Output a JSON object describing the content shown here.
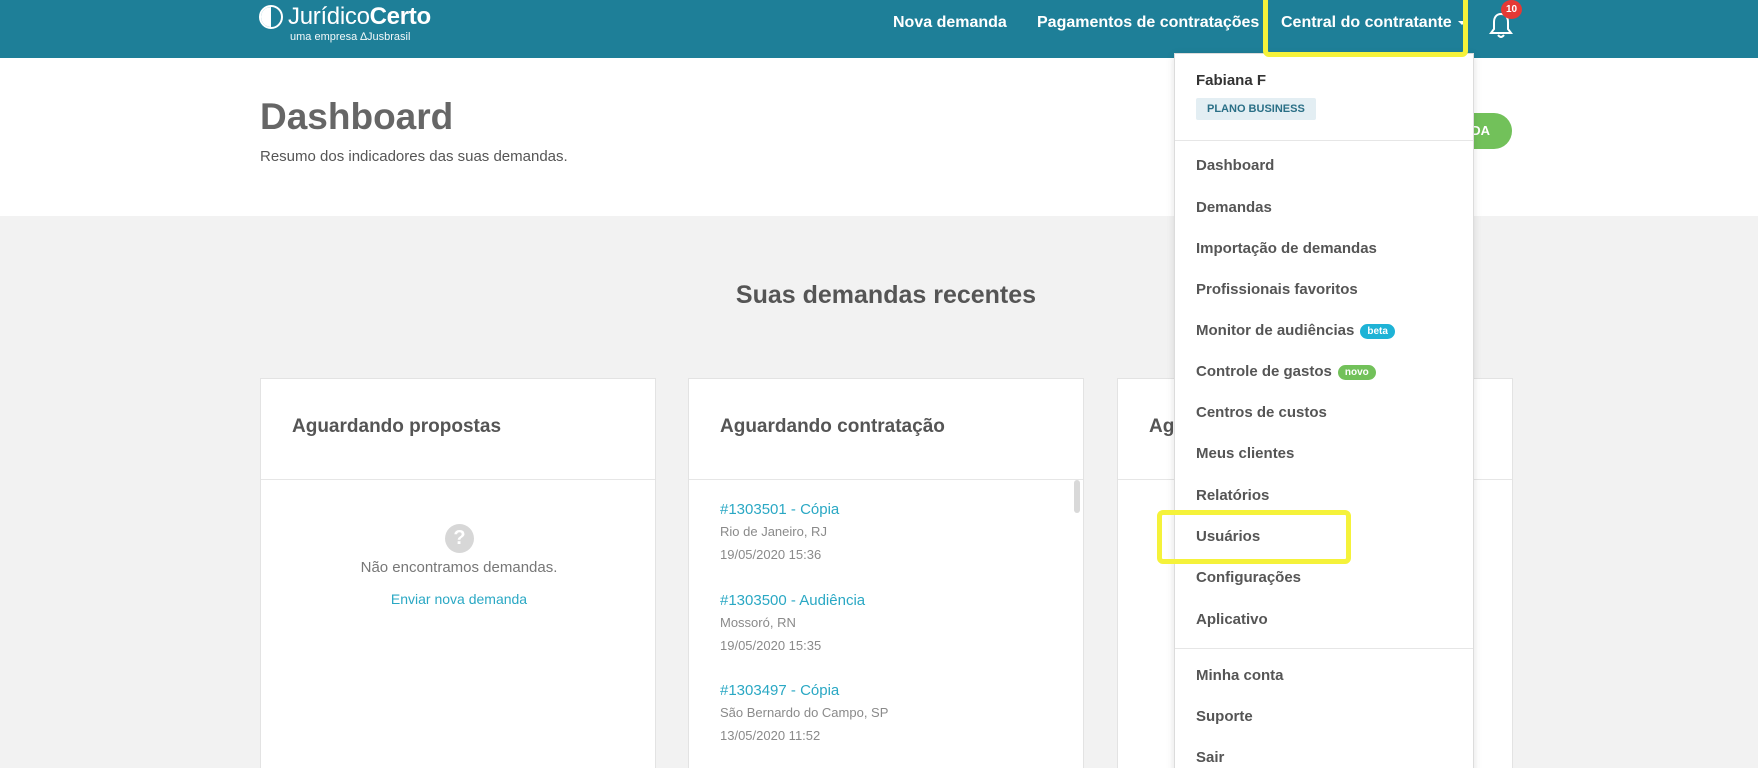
{
  "brand": {
    "name_light": "Jurídico",
    "name_bold": "Certo",
    "subtitle": "uma empresa ∆Jusbrasil"
  },
  "nav": {
    "nova_demanda": "Nova demanda",
    "pagamentos": "Pagamentos de contratações",
    "central": "Central do contratante",
    "notifications_count": "10"
  },
  "header": {
    "title": "Dashboard",
    "subtitle": "Resumo dos indicadores das suas demandas.",
    "button_label": "DA"
  },
  "main": {
    "section_title": "Suas demandas recentes",
    "cards": [
      {
        "title": "Aguardando propostas",
        "empty_text": "Não encontramos demandas.",
        "empty_link": "Enviar nova demanda"
      },
      {
        "title": "Aguardando contratação",
        "demands": [
          {
            "link": "#1303501 - Cópia",
            "location": "Rio de Janeiro, RJ",
            "date": "19/05/2020 15:36"
          },
          {
            "link": "#1303500 - Audiência",
            "location": "Mossoró, RN",
            "date": "19/05/2020 15:35"
          },
          {
            "link": "#1303497 - Cópia",
            "location": "São Bernardo do Campo, SP",
            "date": "13/05/2020 11:52"
          }
        ]
      },
      {
        "title": "Ag"
      }
    ]
  },
  "dropdown": {
    "user_name": "Fabiana F",
    "plan": "PLANO BUSINESS",
    "items": [
      {
        "label": "Dashboard"
      },
      {
        "label": "Demandas"
      },
      {
        "label": "Importação de demandas"
      },
      {
        "label": "Profissionais favoritos"
      },
      {
        "label": "Monitor de audiências",
        "tag": "beta"
      },
      {
        "label": "Controle de gastos",
        "tag": "novo"
      },
      {
        "label": "Centros de custos"
      },
      {
        "label": "Meus clientes"
      },
      {
        "label": "Relatórios"
      },
      {
        "label": "Usuários"
      },
      {
        "label": "Configurações"
      },
      {
        "label": "Aplicativo"
      }
    ],
    "account_items": [
      {
        "label": "Minha conta"
      },
      {
        "label": "Suporte"
      },
      {
        "label": "Sair"
      }
    ]
  },
  "colors": {
    "topbar": "#1e7f98",
    "link": "#2aa8c4",
    "accent_green": "#72c15a",
    "highlight": "#f5f23a",
    "badge": "#e53935"
  }
}
